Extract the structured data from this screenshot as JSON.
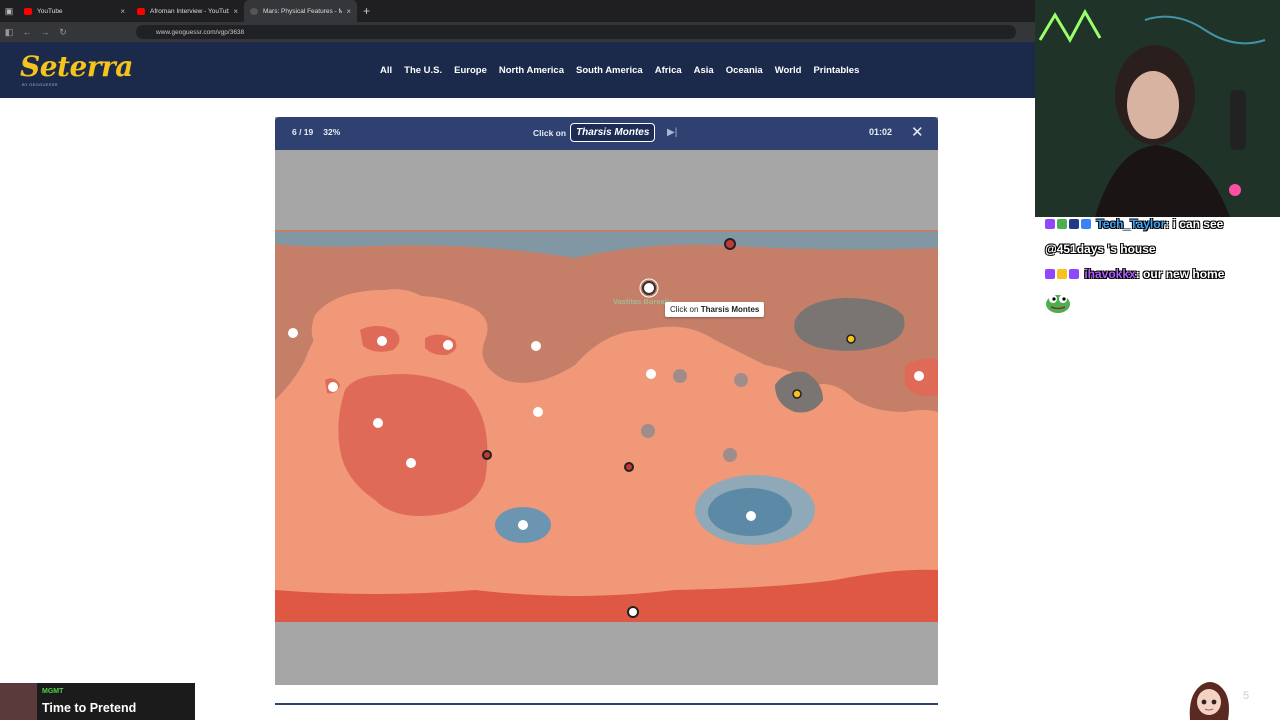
{
  "browser": {
    "tabs": [
      {
        "title": "YouTube",
        "close": "×"
      },
      {
        "title": "Afroman Interview - YouTube",
        "close": "×"
      },
      {
        "title": "Mars: Physical Features - M",
        "close": "×"
      }
    ],
    "new_tab": "+",
    "url": "www.geoguessr.com/vgp/3638"
  },
  "site": {
    "logo": "Seterra",
    "logo_sub": "BY GEOGUESSR",
    "nav": [
      "All",
      "The U.S.",
      "Europe",
      "North America",
      "South America",
      "Africa",
      "Asia",
      "Oceania",
      "World",
      "Printables"
    ]
  },
  "game": {
    "progress": "6 / 19",
    "percent": "32%",
    "prompt_label": "Click on",
    "target": "Tharsis Montes",
    "timer": "01:02",
    "tooltip_prefix": "Click on",
    "tooltip_target": "Tharsis Montes",
    "ghost_label": "Vastitas Borealis"
  },
  "chat": {
    "messages": [
      {
        "user": "Tech_Taylor",
        "text": ": i can see"
      },
      {
        "user": "",
        "text": "@451days 's house"
      },
      {
        "user": "ihavokkx",
        "text": ": our new home"
      }
    ]
  },
  "now_playing": {
    "artist": "MGMT",
    "title": "Time to Pretend"
  },
  "viewer_count": "5",
  "colors": {
    "header": "#1b2a4a",
    "accent": "#f6c21c",
    "gamebar": "#2e4170",
    "mars_lowland": "#c57f68",
    "mars_highland": "#f09878"
  }
}
